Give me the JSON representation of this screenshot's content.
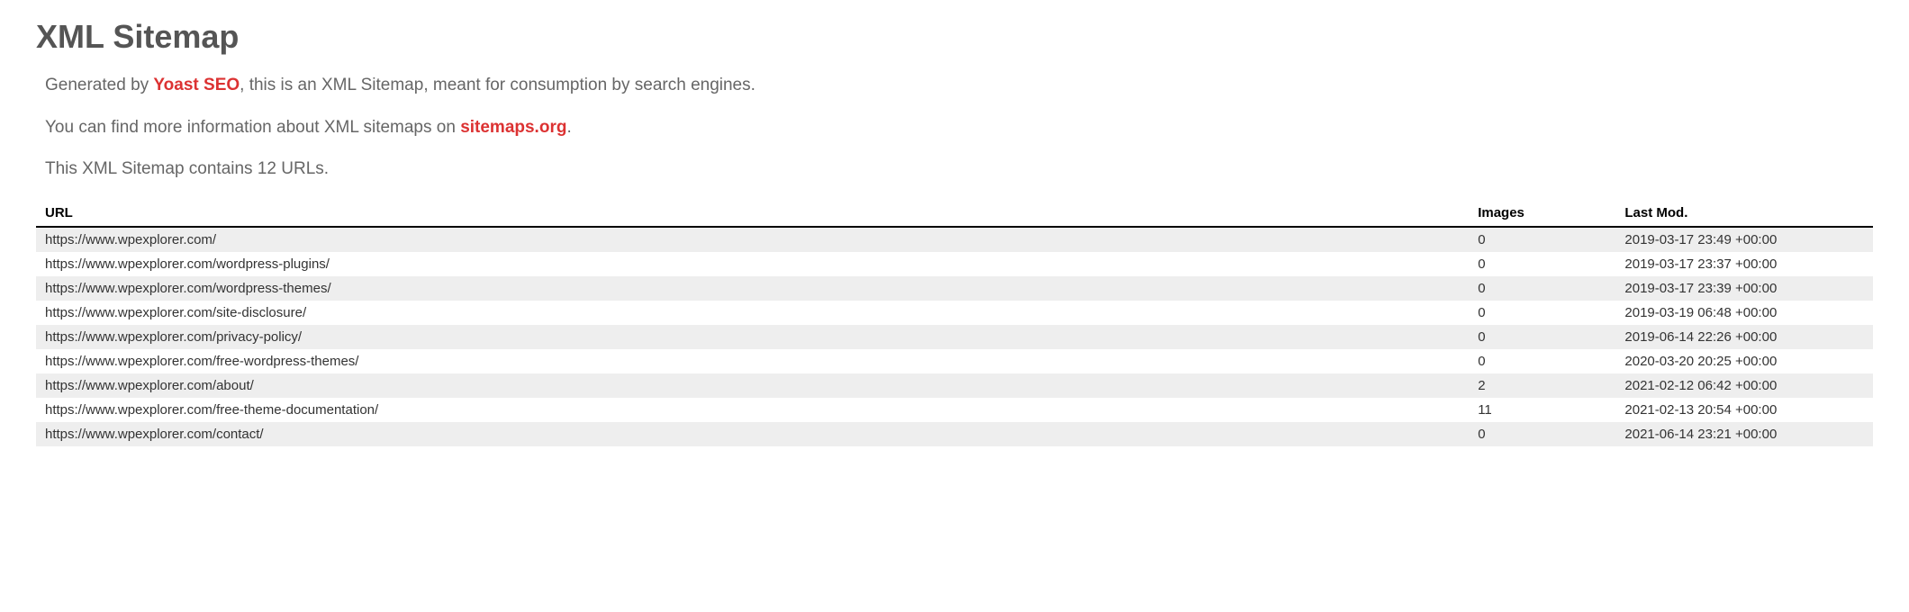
{
  "page_title": "XML Sitemap",
  "intro": {
    "line1_prefix": "Generated by ",
    "link1_text": "Yoast SEO",
    "line1_suffix": ", this is an XML Sitemap, meant for consumption by search engines.",
    "line2_prefix": "You can find more information about XML sitemaps on ",
    "link2_text": "sitemaps.org",
    "line2_suffix": ".",
    "count_line": "This XML Sitemap contains 12 URLs."
  },
  "table": {
    "headers": {
      "url": "URL",
      "images": "Images",
      "lastmod": "Last Mod."
    },
    "rows": [
      {
        "url": "https://www.wpexplorer.com/",
        "images": "0",
        "lastmod": "2019-03-17 23:49 +00:00"
      },
      {
        "url": "https://www.wpexplorer.com/wordpress-plugins/",
        "images": "0",
        "lastmod": "2019-03-17 23:37 +00:00"
      },
      {
        "url": "https://www.wpexplorer.com/wordpress-themes/",
        "images": "0",
        "lastmod": "2019-03-17 23:39 +00:00"
      },
      {
        "url": "https://www.wpexplorer.com/site-disclosure/",
        "images": "0",
        "lastmod": "2019-03-19 06:48 +00:00"
      },
      {
        "url": "https://www.wpexplorer.com/privacy-policy/",
        "images": "0",
        "lastmod": "2019-06-14 22:26 +00:00"
      },
      {
        "url": "https://www.wpexplorer.com/free-wordpress-themes/",
        "images": "0",
        "lastmod": "2020-03-20 20:25 +00:00"
      },
      {
        "url": "https://www.wpexplorer.com/about/",
        "images": "2",
        "lastmod": "2021-02-12 06:42 +00:00"
      },
      {
        "url": "https://www.wpexplorer.com/free-theme-documentation/",
        "images": "11",
        "lastmod": "2021-02-13 20:54 +00:00"
      },
      {
        "url": "https://www.wpexplorer.com/contact/",
        "images": "0",
        "lastmod": "2021-06-14 23:21 +00:00"
      }
    ]
  }
}
